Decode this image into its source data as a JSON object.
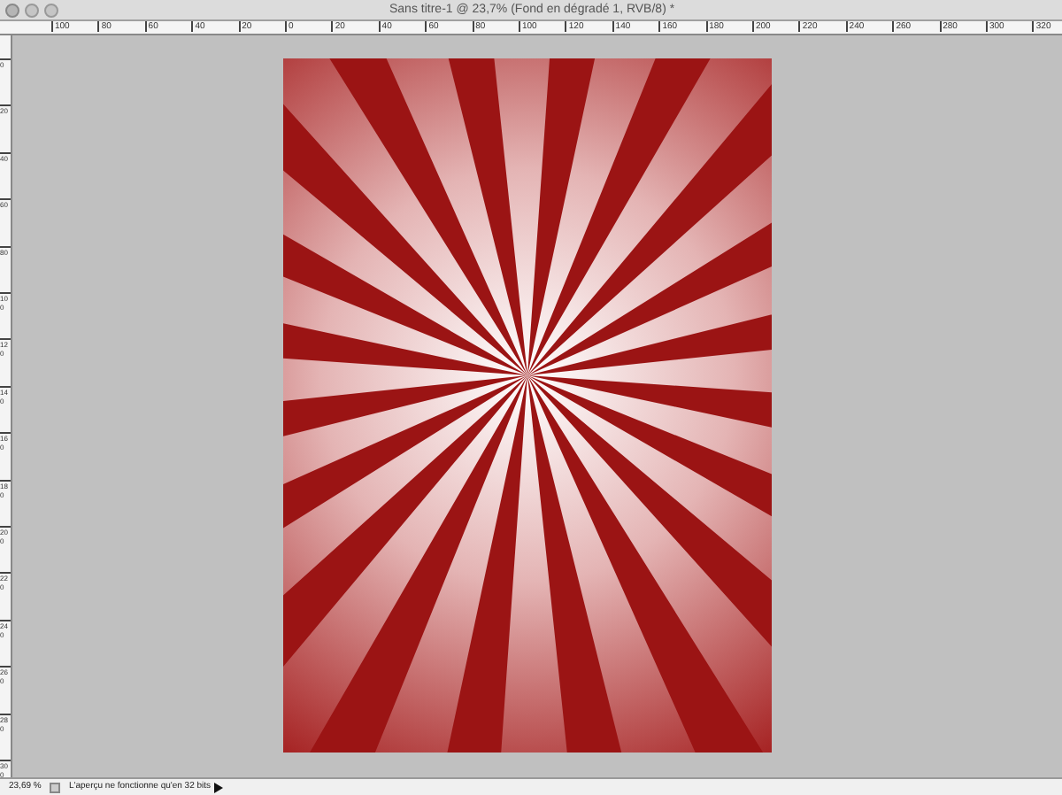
{
  "window": {
    "title": "Sans titre-1 @ 23,7% (Fond en dégradé 1, RVB/8) *"
  },
  "horizontal_ruler": {
    "labels": [
      "100",
      "80",
      "60",
      "40",
      "20",
      "0",
      "20",
      "40",
      "60",
      "80",
      "100",
      "120",
      "140",
      "160",
      "180",
      "200",
      "220",
      "240",
      "260",
      "280",
      "300",
      "320"
    ]
  },
  "vertical_ruler": {
    "labels": [
      "0",
      "20",
      "40",
      "60",
      "80",
      "100",
      "120",
      "140",
      "160",
      "180",
      "200",
      "220",
      "240",
      "260",
      "280",
      "300"
    ]
  },
  "status_bar": {
    "zoom": "23,69 %",
    "message": "L'aperçu ne fonctionne qu'en 32 bits"
  }
}
